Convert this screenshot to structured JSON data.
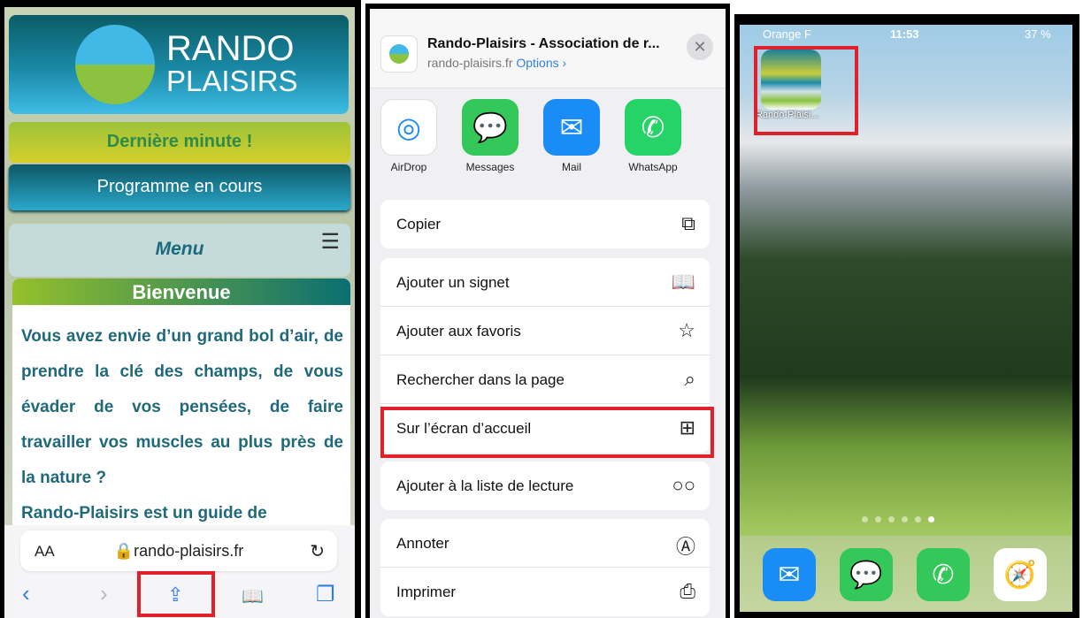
{
  "safari": {
    "logo": {
      "line1": "RANDO",
      "line2": "PLAISIRS"
    },
    "last_minute": "Dernière minute !",
    "program": "Programme en cours",
    "menu": "Menu",
    "menu_icon": "☰",
    "welcome_title": "Bienvenue",
    "welcome_text": "Vous avez envie d’un grand bol d’air, de prendre la clé des champs, de vous évader de vos pensées, de faire travailler vos muscles au plus près de la nature ?",
    "cut_text": "Rando-Plaisirs est un guide de",
    "text_size": "AA",
    "url": "🔒rando-plaisirs.fr",
    "reload": "↻",
    "back": "‹",
    "forward": "›",
    "share": "⇪",
    "bookmarks": "📖",
    "tabs": "❐",
    "highlight_color": "#e0212b"
  },
  "share_sheet": {
    "title": "Rando-Plaisirs - Association de r...",
    "domain": "rando-plaisirs.fr",
    "options": "Options ›",
    "close": "✕",
    "apps": [
      {
        "label": "AirDrop",
        "color": "#ffffff",
        "icon": "airdrop-icon",
        "glyph": "◎"
      },
      {
        "label": "Messages",
        "color": "#34c759",
        "icon": "messages-icon",
        "glyph": "💬"
      },
      {
        "label": "Mail",
        "color": "#1a8cf5",
        "icon": "mail-icon",
        "glyph": "✉"
      },
      {
        "label": "WhatsApp",
        "color": "#25d366",
        "icon": "whatsapp-icon",
        "glyph": "✆"
      }
    ],
    "group1": [
      {
        "label": "Copier",
        "icon": "⧉"
      }
    ],
    "group2": [
      {
        "label": "Ajouter un signet",
        "icon": "📖"
      },
      {
        "label": "Ajouter aux favoris",
        "icon": "☆"
      },
      {
        "label": "Rechercher dans la page",
        "icon": "⌕"
      },
      {
        "label": "Sur l’écran d’accueil",
        "icon": "⊞"
      }
    ],
    "group3": [
      {
        "label": "Ajouter à la liste de lecture",
        "icon": "○○"
      }
    ],
    "group4": [
      {
        "label": "Annoter",
        "icon": "Ⓐ"
      },
      {
        "label": "Imprimer",
        "icon": "⎙"
      }
    ]
  },
  "home": {
    "carrier": "Orange F",
    "time": "11:53",
    "battery": "37 %",
    "app_label": "Rando-Plaisi...",
    "page_dots": 6,
    "active_dot": 6,
    "dock": [
      {
        "name": "mail",
        "glyph": "✉",
        "color": "#1a8cf5"
      },
      {
        "name": "messages",
        "glyph": "💬",
        "color": "#34c759"
      },
      {
        "name": "phone",
        "glyph": "✆",
        "color": "#34c759"
      },
      {
        "name": "safari",
        "glyph": "🧭",
        "color": "#ffffff"
      }
    ]
  }
}
